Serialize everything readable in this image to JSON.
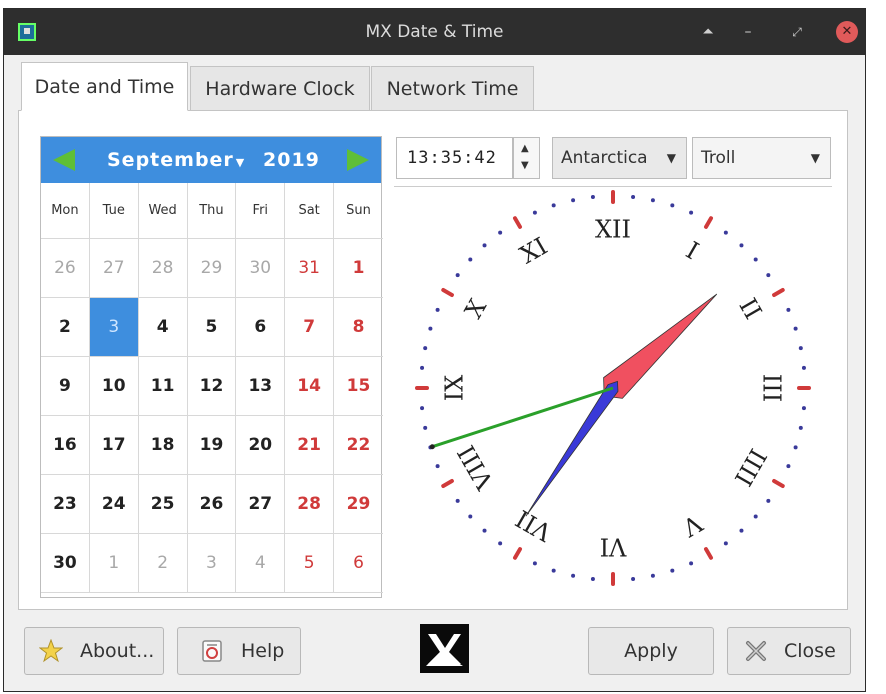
{
  "window": {
    "title": "MX Date & Time"
  },
  "titlebar": {
    "icons": [
      "app-icon",
      "shade-icon",
      "minimize-icon",
      "restore-icon",
      "close-icon"
    ]
  },
  "tabs": [
    {
      "label": "Date and Time",
      "active": true
    },
    {
      "label": "Hardware Clock",
      "active": false
    },
    {
      "label": "Network Time",
      "active": false
    }
  ],
  "calendar": {
    "month": "September",
    "year": "2019",
    "weekdays": [
      "Mon",
      "Tue",
      "Wed",
      "Thu",
      "Fri",
      "Sat",
      "Sun"
    ],
    "weeks": [
      [
        "26",
        "27",
        "28",
        "29",
        "30",
        "31",
        "1"
      ],
      [
        "2",
        "3",
        "4",
        "5",
        "6",
        "7",
        "8"
      ],
      [
        "9",
        "10",
        "11",
        "12",
        "13",
        "14",
        "15"
      ],
      [
        "16",
        "17",
        "18",
        "19",
        "20",
        "21",
        "22"
      ],
      [
        "23",
        "24",
        "25",
        "26",
        "27",
        "28",
        "29"
      ],
      [
        "30",
        "1",
        "2",
        "3",
        "4",
        "5",
        "6"
      ]
    ],
    "selected_day": "3",
    "colors": {
      "header": "#3e8ede",
      "weekend": "#d03a3a",
      "arrows": "#5fbf37"
    }
  },
  "time": {
    "value": "13:35:42"
  },
  "timezone": {
    "region": "Antarctica",
    "city": "Troll"
  },
  "clock": {
    "numerals": [
      "XII",
      "I",
      "II",
      "III",
      "IIII",
      "V",
      "VI",
      "VII",
      "VIII",
      "IX",
      "X",
      "XI"
    ],
    "hour": 13,
    "minute": 35,
    "second": 42,
    "colors": {
      "hour_hand": "#f05060",
      "minute_hand": "#3a3ad8",
      "second_hand": "#2aa02a",
      "tick_minor": "#3a3a9a",
      "tick_major": "#d03a3a"
    }
  },
  "buttons": {
    "about": "About...",
    "help": "Help",
    "apply": "Apply",
    "close": "Close"
  }
}
